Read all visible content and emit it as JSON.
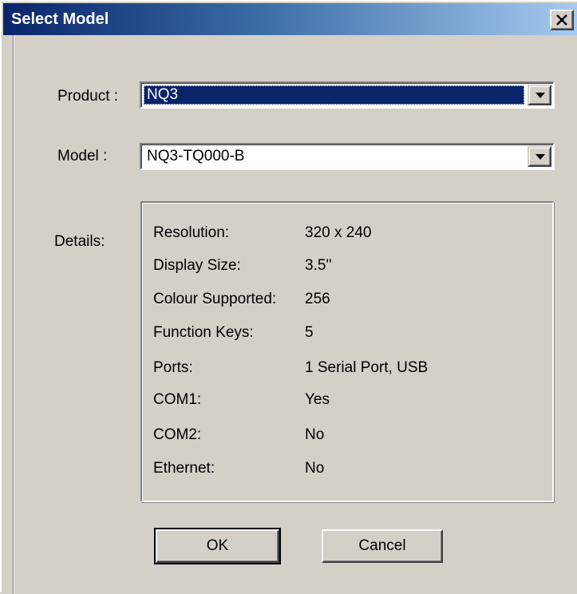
{
  "window": {
    "title": "Select Model"
  },
  "form": {
    "product_label": "Product :",
    "product_value": "NQ3",
    "model_label": "Model :",
    "model_value": "NQ3-TQ000-B",
    "details_label": "Details:"
  },
  "details": [
    {
      "key": "Resolution:",
      "value": "320 x 240"
    },
    {
      "key": "Display Size:",
      "value": "3.5''"
    },
    {
      "key": "Colour Supported:",
      "value": "256"
    },
    {
      "key": "Function Keys:",
      "value": "5"
    },
    {
      "key": "Ports:",
      "value": "1 Serial Port, USB"
    },
    {
      "key": "COM1:",
      "value": "Yes"
    },
    {
      "key": "COM2:",
      "value": "No"
    },
    {
      "key": "Ethernet:",
      "value": "No"
    }
  ],
  "buttons": {
    "ok_label": "OK",
    "cancel_label": "Cancel"
  },
  "icons": {
    "close": "close-icon",
    "dropdown": "chevron-down-icon"
  },
  "colors": {
    "title_bar": "#0a246a",
    "selection": "#0a246a",
    "face": "#d4d0c8"
  }
}
